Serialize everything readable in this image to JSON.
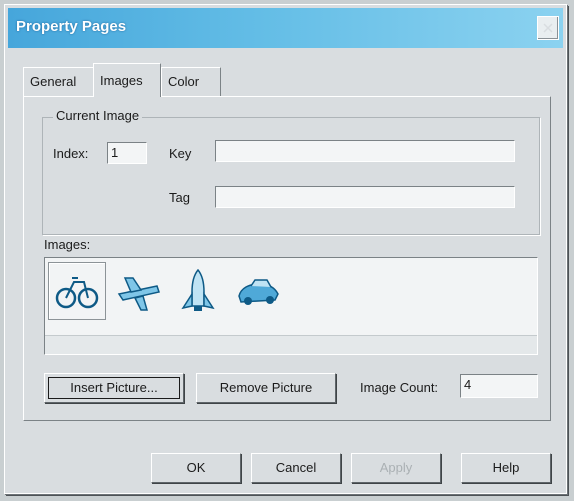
{
  "window": {
    "title": "Property Pages"
  },
  "tabs": [
    "General",
    "Images",
    "Color"
  ],
  "current_image": {
    "group_label": "Current Image",
    "index_label": "Index:",
    "index_value": "1",
    "key_label": "Key",
    "key_value": "",
    "tag_label": "Tag",
    "tag_value": ""
  },
  "images": {
    "label": "Images:",
    "items": [
      "bicycle-icon",
      "airplane-icon",
      "space-shuttle-icon",
      "car-icon"
    ]
  },
  "actions": {
    "insert_picture": "Insert Picture...",
    "remove_picture": "Remove Picture",
    "image_count_label": "Image Count:",
    "image_count_value": "4"
  },
  "footer": {
    "ok": "OK",
    "cancel": "Cancel",
    "apply": "Apply",
    "help": "Help"
  }
}
